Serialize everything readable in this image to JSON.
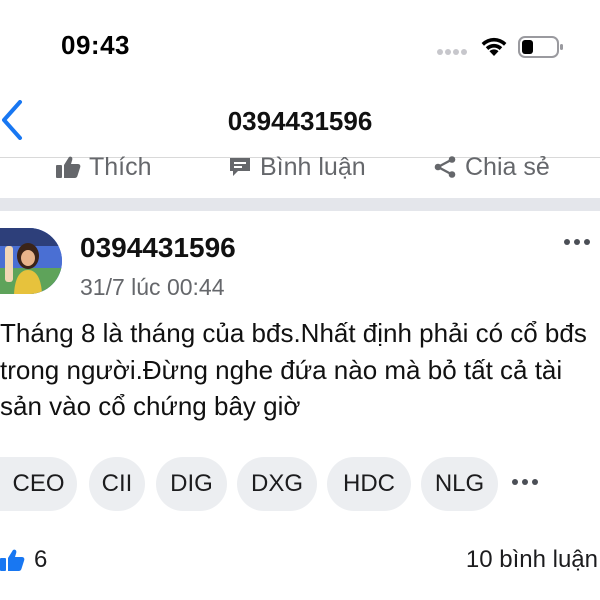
{
  "status_bar": {
    "time": "09:43"
  },
  "nav": {
    "title": "0394431596"
  },
  "actions": {
    "like_label": "Thích",
    "comment_label": "Bình luận",
    "share_label": "Chia sẻ"
  },
  "post": {
    "author": "0394431596",
    "timestamp": "31/7 lúc 00:44",
    "text": "Tháng 8 là tháng của bđs.Nhất định phải có cổ bđs trong người.Đừng nghe đứa nào mà bỏ tất cả tài sản vào cổ chứng bây giờ",
    "tags": [
      "CEO",
      "CII",
      "DIG",
      "DXG",
      "HDC",
      "NLG"
    ],
    "likes": "6",
    "comments": "10 bình luận"
  },
  "colors": {
    "accent": "#1877f2",
    "text_secondary": "#65676b",
    "divider": "#e4e6eb",
    "chip_bg": "#eceef1"
  },
  "icons": {
    "back": "chevron-left-icon",
    "like": "thumbs-up-icon",
    "comment": "comment-bubble-icon",
    "share": "share-icon",
    "more": "more-horizontal-icon"
  }
}
